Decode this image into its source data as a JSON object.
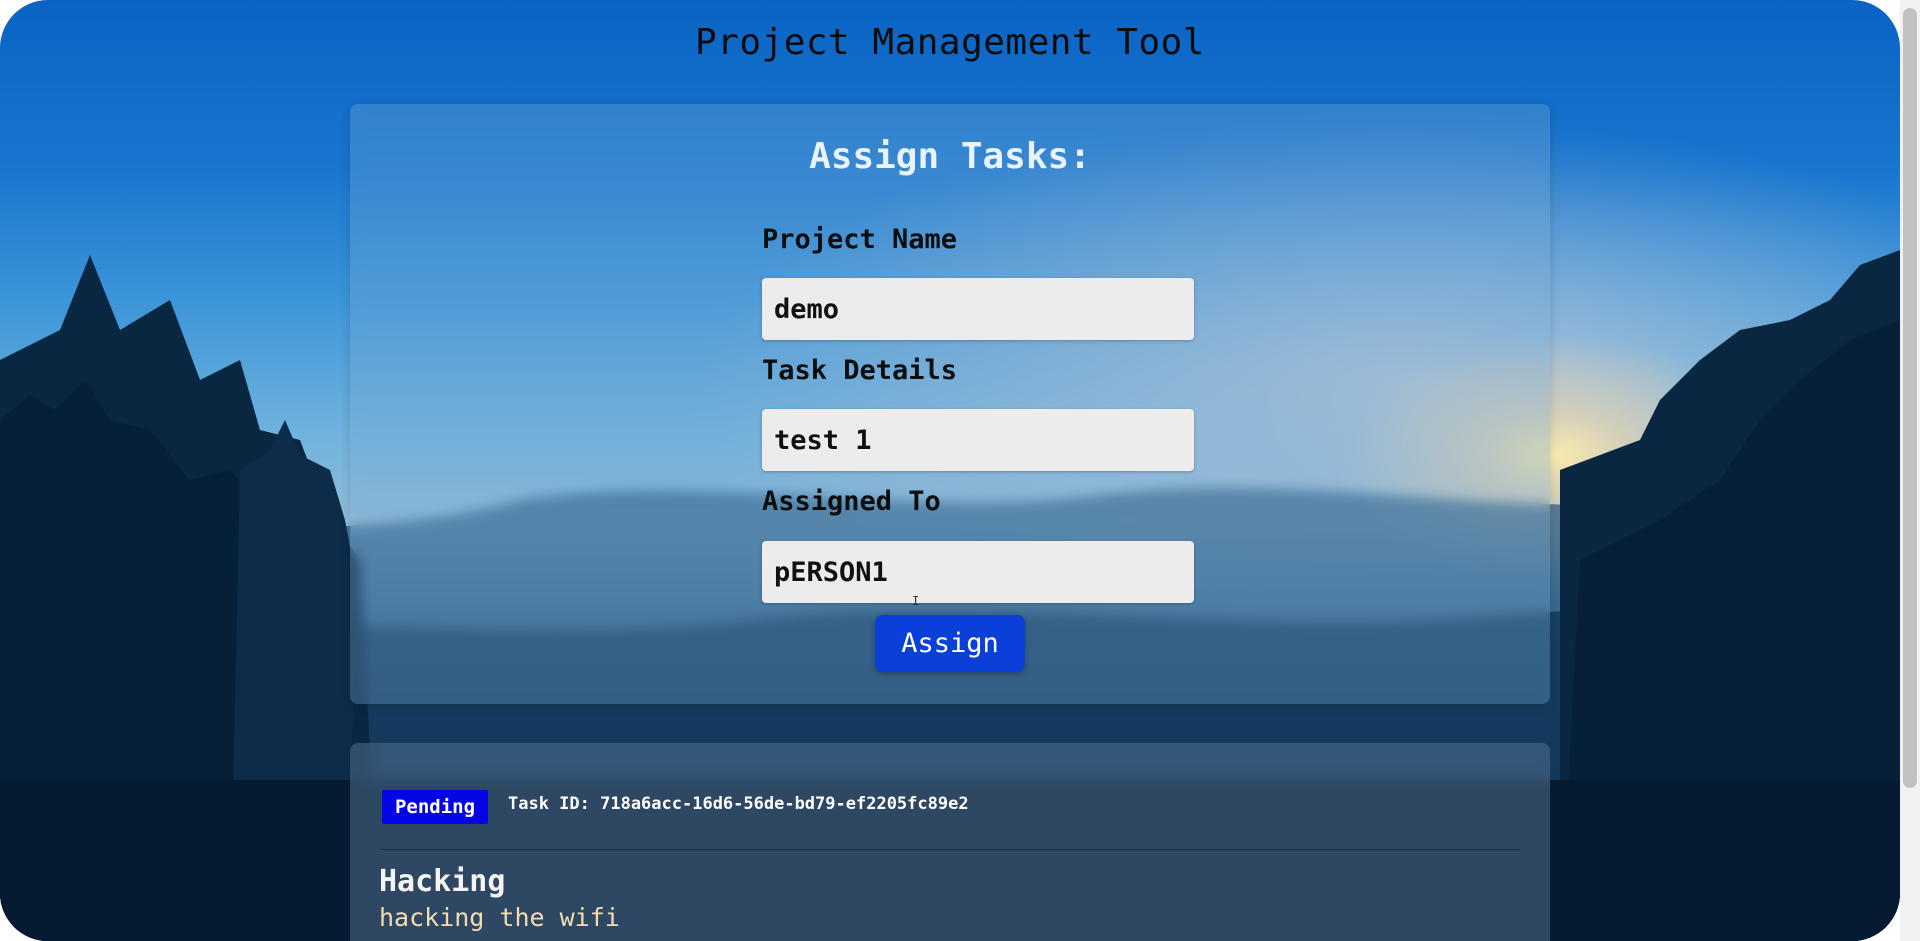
{
  "app": {
    "title": "Project Management Tool"
  },
  "form": {
    "heading": "Assign Tasks:",
    "project_name": {
      "label": "Project Name",
      "value": "demo"
    },
    "task_details": {
      "label": "Task Details",
      "value": "test 1"
    },
    "assigned_to": {
      "label": "Assigned To",
      "value": "pERSON1"
    },
    "submit_label": "Assign"
  },
  "tasks": [
    {
      "status": "Pending",
      "id_text": "Task ID: 718a6acc-16d6-56de-bd79-ef2205fc89e2",
      "title": "Hacking",
      "description": "hacking the wifi"
    }
  ],
  "colors": {
    "button": "#0a3fd8",
    "status_pending": "#0505e6",
    "description_text": "#f3ddb0"
  }
}
